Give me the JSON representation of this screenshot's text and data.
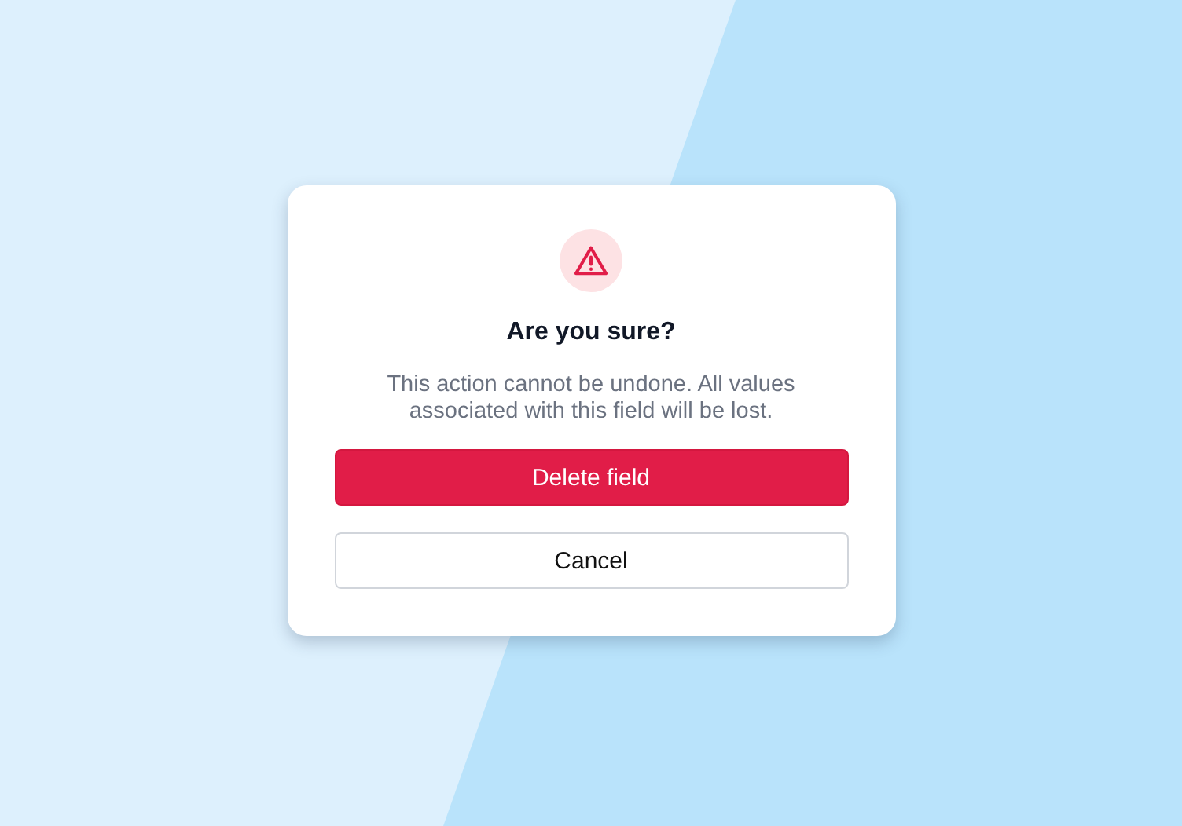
{
  "dialog": {
    "title": "Are you sure?",
    "message": "This action cannot be undone. All values associated with this field will be lost.",
    "buttons": [
      {
        "label": "Delete field",
        "kind": "danger"
      },
      {
        "label": "Cancel",
        "kind": "secondary"
      }
    ]
  }
}
